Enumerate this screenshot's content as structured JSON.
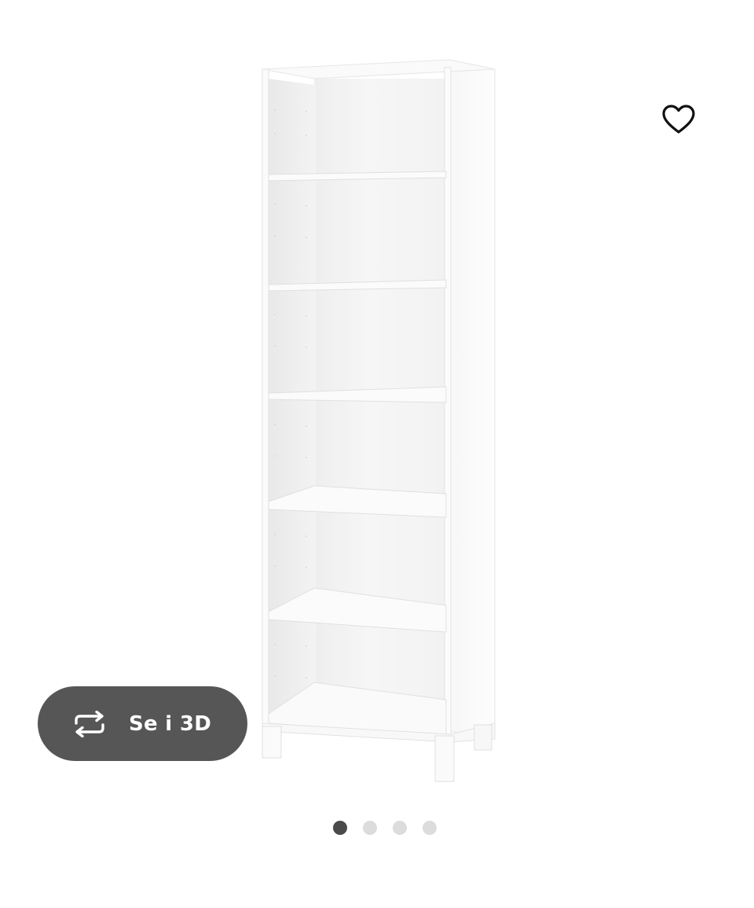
{
  "product": {
    "image_name": "white-bookcase-image"
  },
  "favorite": {
    "icon": "heart-outline-icon"
  },
  "view_3d": {
    "label": "Se i 3D",
    "icon": "rotate-3d-icon"
  },
  "carousel": {
    "total_slides": 4,
    "active_index": 0
  },
  "colors": {
    "button_bg": "#565656",
    "dot_active": "#4a4a4a",
    "dot_inactive": "#dcdcdc",
    "icon_stroke": "#111111"
  }
}
